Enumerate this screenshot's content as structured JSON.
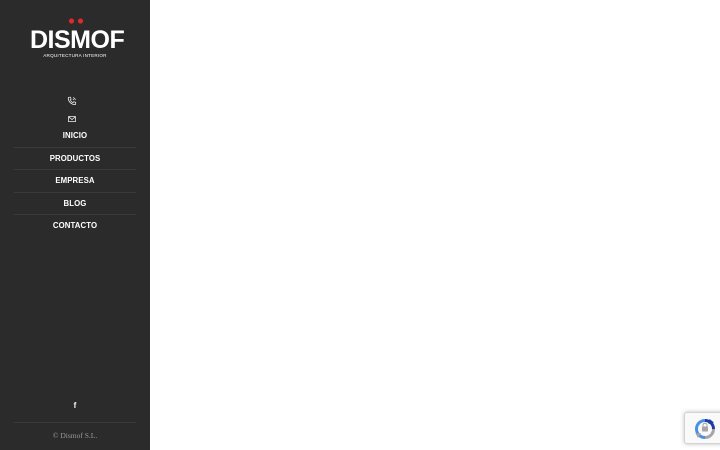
{
  "brand": {
    "name": "DISMOF",
    "tagline": "ARQUITECTURA INTERIOR",
    "accent_color": "#d92b2b"
  },
  "contact_icons": [
    "phone-icon",
    "mail-icon"
  ],
  "nav": {
    "items": [
      {
        "label": "INICIO"
      },
      {
        "label": "PRODUCTOS"
      },
      {
        "label": "EMPRESA"
      },
      {
        "label": "BLOG"
      },
      {
        "label": "CONTACTO"
      }
    ]
  },
  "social": {
    "facebook_glyph": "f"
  },
  "footer": {
    "copyright": "© Dismof S.L."
  },
  "recaptcha": {
    "icon": "recaptcha-icon"
  }
}
